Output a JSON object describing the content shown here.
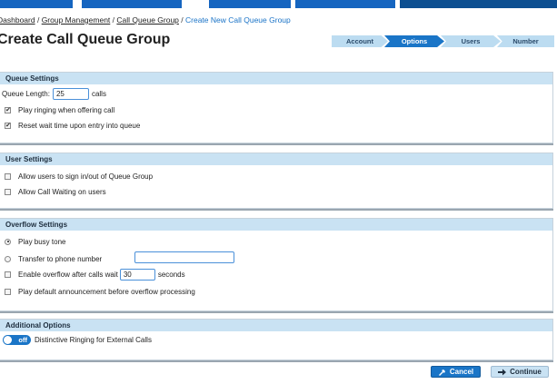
{
  "breadcrumb": {
    "items": [
      "Dashboard",
      "Group Management",
      "Call Queue Group"
    ],
    "separator": " / ",
    "current": "Create New Call Queue Group"
  },
  "page_title": "Create Call Queue Group",
  "wizard": {
    "steps": [
      "Account",
      "Options",
      "Users",
      "Number"
    ],
    "active": "Options"
  },
  "queue_settings": {
    "title": "Queue Settings",
    "queue_length_label": "Queue Length:",
    "queue_length_value": "25",
    "queue_length_unit": "calls",
    "play_ringing_label": "Play ringing when offering call",
    "play_ringing_checked": true,
    "reset_wait_label": "Reset wait time upon entry into queue",
    "reset_wait_checked": true
  },
  "user_settings": {
    "title": "User Settings",
    "allow_signin_label": "Allow users to sign in/out of Queue Group",
    "allow_call_waiting_label": "Allow Call Waiting on users"
  },
  "overflow_settings": {
    "title": "Overflow Settings",
    "busy_tone_label": "Play busy tone",
    "busy_tone_selected": true,
    "transfer_label": "Transfer to phone number",
    "transfer_value": "",
    "enable_overflow_label": "Enable overflow after calls wait",
    "overflow_wait_value": "30",
    "overflow_wait_unit": "seconds",
    "default_announcement_label": "Play default announcement before overflow processing"
  },
  "additional_options": {
    "title": "Additional Options",
    "toggle_state": "off",
    "distinctive_ringing_label": "Distinctive Ringing for External Calls"
  },
  "buttons": {
    "cancel": "Cancel",
    "continue": "Continue"
  },
  "colors": {
    "primary": "#1a75c7",
    "panel_header": "#c9e2f3",
    "link": "#1a73c7"
  }
}
